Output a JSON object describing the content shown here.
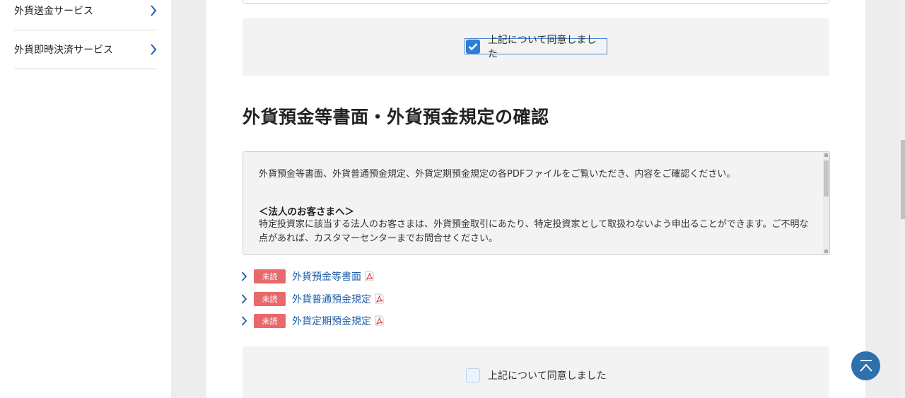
{
  "sidebar": {
    "items": [
      {
        "label": "外貨送金サービス"
      },
      {
        "label": "外貨即時決済サービス"
      }
    ]
  },
  "agreement_top": {
    "label": "上記について同意しました",
    "checked": true
  },
  "section": {
    "title": "外貨預金等書面・外貨預金規定の確認",
    "info": {
      "line1": "外貨預金等書面、外貨普通預金規定、外貨定期預金規定の各PDFファイルをご覧いただき、内容をご確認ください。",
      "subhead": "＜法人のお客さまへ＞",
      "body": "特定投資家に該当する法人のお客さまは、外貨預金取引にあたり、特定投資家として取扱わないよう申出ることができます。ご不明な点があれば、カスタマーセンターまでお問合せください。"
    },
    "documents": [
      {
        "badge": "未読",
        "label": "外貨預金等書面"
      },
      {
        "badge": "未読",
        "label": "外貨普通預金規定"
      },
      {
        "badge": "未読",
        "label": "外貨定期預金規定"
      }
    ]
  },
  "agreement_bottom": {
    "label": "上記について同意しました",
    "checked": false
  },
  "icons": {
    "chevron": "chevron-right-icon",
    "pdf": "pdf-icon",
    "back_to_top": "arrow-up-icon",
    "check": "check-icon"
  },
  "colors": {
    "accent": "#2f7dd4",
    "badge": "#e8686b",
    "link": "#1f5ea8",
    "back_to_top": "#2e6fae"
  }
}
